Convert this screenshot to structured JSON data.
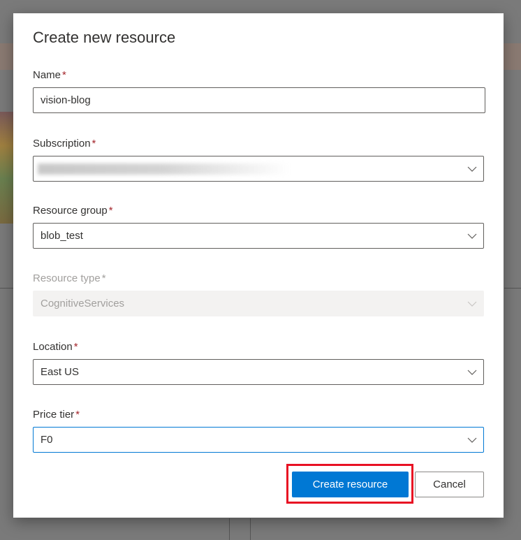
{
  "dialog": {
    "title": "Create new resource",
    "required_marker": "*"
  },
  "fields": {
    "name": {
      "label": "Name",
      "value": "vision-blog"
    },
    "subscription": {
      "label": "Subscription",
      "value": ""
    },
    "resource_group": {
      "label": "Resource group",
      "value": "blob_test"
    },
    "resource_type": {
      "label": "Resource type",
      "value": "CognitiveServices",
      "disabled": true
    },
    "location": {
      "label": "Location",
      "value": "East US"
    },
    "price_tier": {
      "label": "Price tier",
      "value": "F0",
      "focused": true
    }
  },
  "actions": {
    "create_label": "Create resource",
    "cancel_label": "Cancel"
  },
  "icons": {
    "dropdown": "chevron-down-icon"
  },
  "colors": {
    "accent": "#0078d4",
    "required": "#a4262c",
    "highlight": "#e81123"
  }
}
